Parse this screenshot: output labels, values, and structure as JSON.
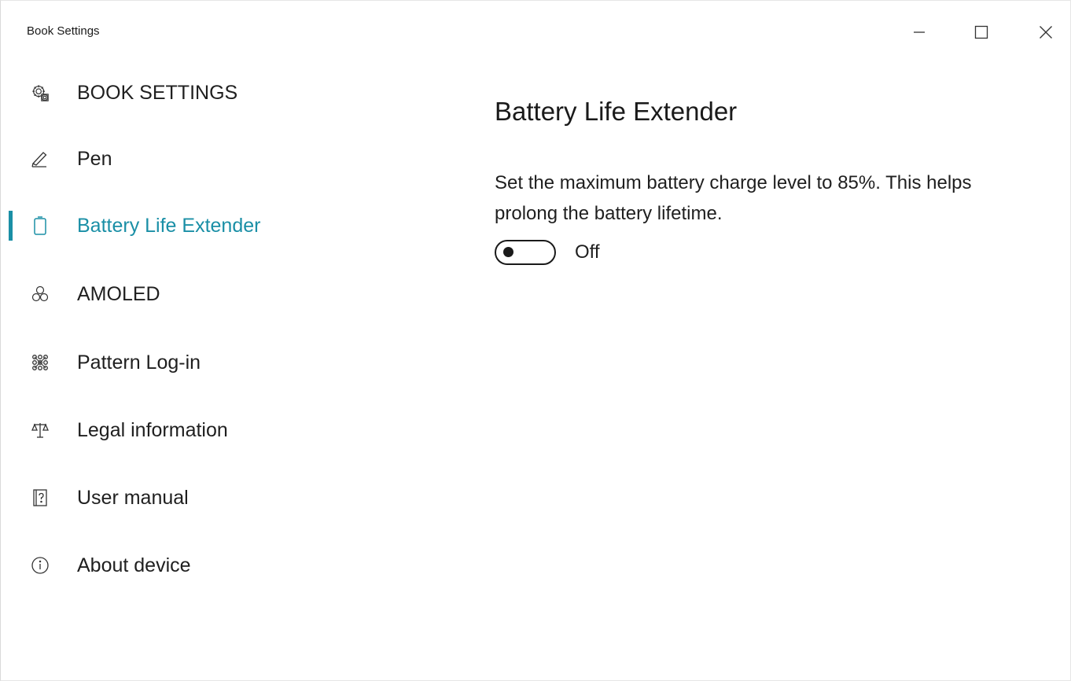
{
  "window": {
    "title": "Book Settings",
    "accent_color": "#1a8fa6"
  },
  "sidebar": {
    "items": [
      {
        "label": "BOOK SETTINGS",
        "icon": "gear-icon"
      },
      {
        "label": "Pen",
        "icon": "pen-icon"
      },
      {
        "label": "Battery Life Extender",
        "icon": "battery-icon",
        "selected": true
      },
      {
        "label": "AMOLED",
        "icon": "amoled-icon"
      },
      {
        "label": "Pattern Log-in",
        "icon": "pattern-grid-icon"
      },
      {
        "label": "Legal information",
        "icon": "scales-icon"
      },
      {
        "label": "User manual",
        "icon": "help-book-icon"
      },
      {
        "label": "About device",
        "icon": "info-icon"
      }
    ]
  },
  "content": {
    "title": "Battery Life Extender",
    "description": "Set the maximum battery charge level to 85%. This helps prolong the battery lifetime.",
    "toggle": {
      "state": "Off",
      "on": false
    }
  }
}
